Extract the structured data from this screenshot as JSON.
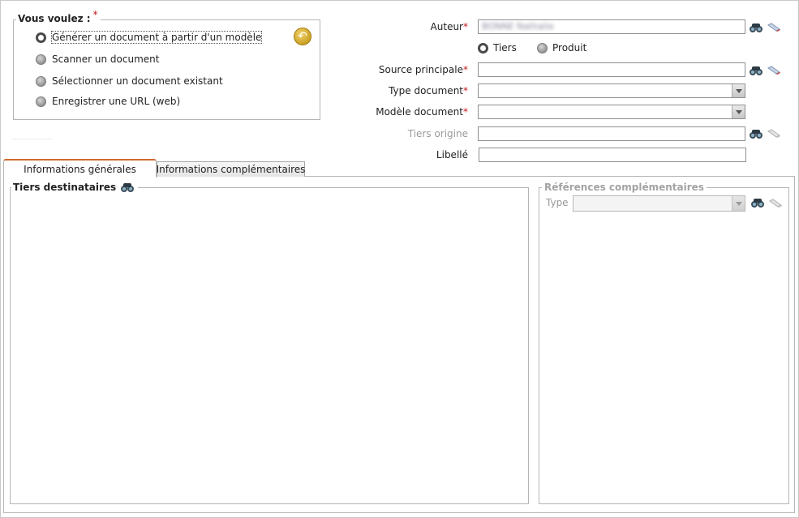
{
  "vous_voulez": {
    "legend": "Vous voulez :",
    "required_mark": "*",
    "options": [
      {
        "label": "Générer un document à partir d'un modèle",
        "selected": true
      },
      {
        "label": "Scanner un document",
        "selected": false
      },
      {
        "label": "Sélectionner un document existant",
        "selected": false
      },
      {
        "label": "Enregistrer une URL (web)",
        "selected": false
      }
    ],
    "back_icon": "undo-arrow-icon"
  },
  "form": {
    "auteur": {
      "label": "Auteur",
      "required_mark": "*",
      "value": "BONNE Nathalie"
    },
    "target_type": {
      "tiers": "Tiers",
      "produit": "Produit",
      "selected": "Tiers"
    },
    "source_principale": {
      "label": "Source principale",
      "required_mark": "*",
      "value": ""
    },
    "type_document": {
      "label": "Type document",
      "required_mark": "*",
      "value": ""
    },
    "modele_document": {
      "label": "Modèle document",
      "required_mark": "*",
      "value": ""
    },
    "tiers_origine": {
      "label": "Tiers origine",
      "value": "",
      "disabled": true
    },
    "libelle": {
      "label": "Libellé",
      "value": ""
    }
  },
  "tabs": [
    {
      "label": "Informations générales",
      "active": true
    },
    {
      "label": "Informations complémentaires",
      "active": false
    }
  ],
  "tiers_destinataires": {
    "legend": "Tiers destinataires"
  },
  "references_complementaires": {
    "legend": "Références complémentaires",
    "type_label": "Type",
    "type_value": "",
    "disabled": true
  },
  "colors": {
    "required": "#c21818",
    "tab_accent": "#d16b30",
    "border": "#b5b5b5",
    "disabled_text": "#9a9a9a"
  }
}
